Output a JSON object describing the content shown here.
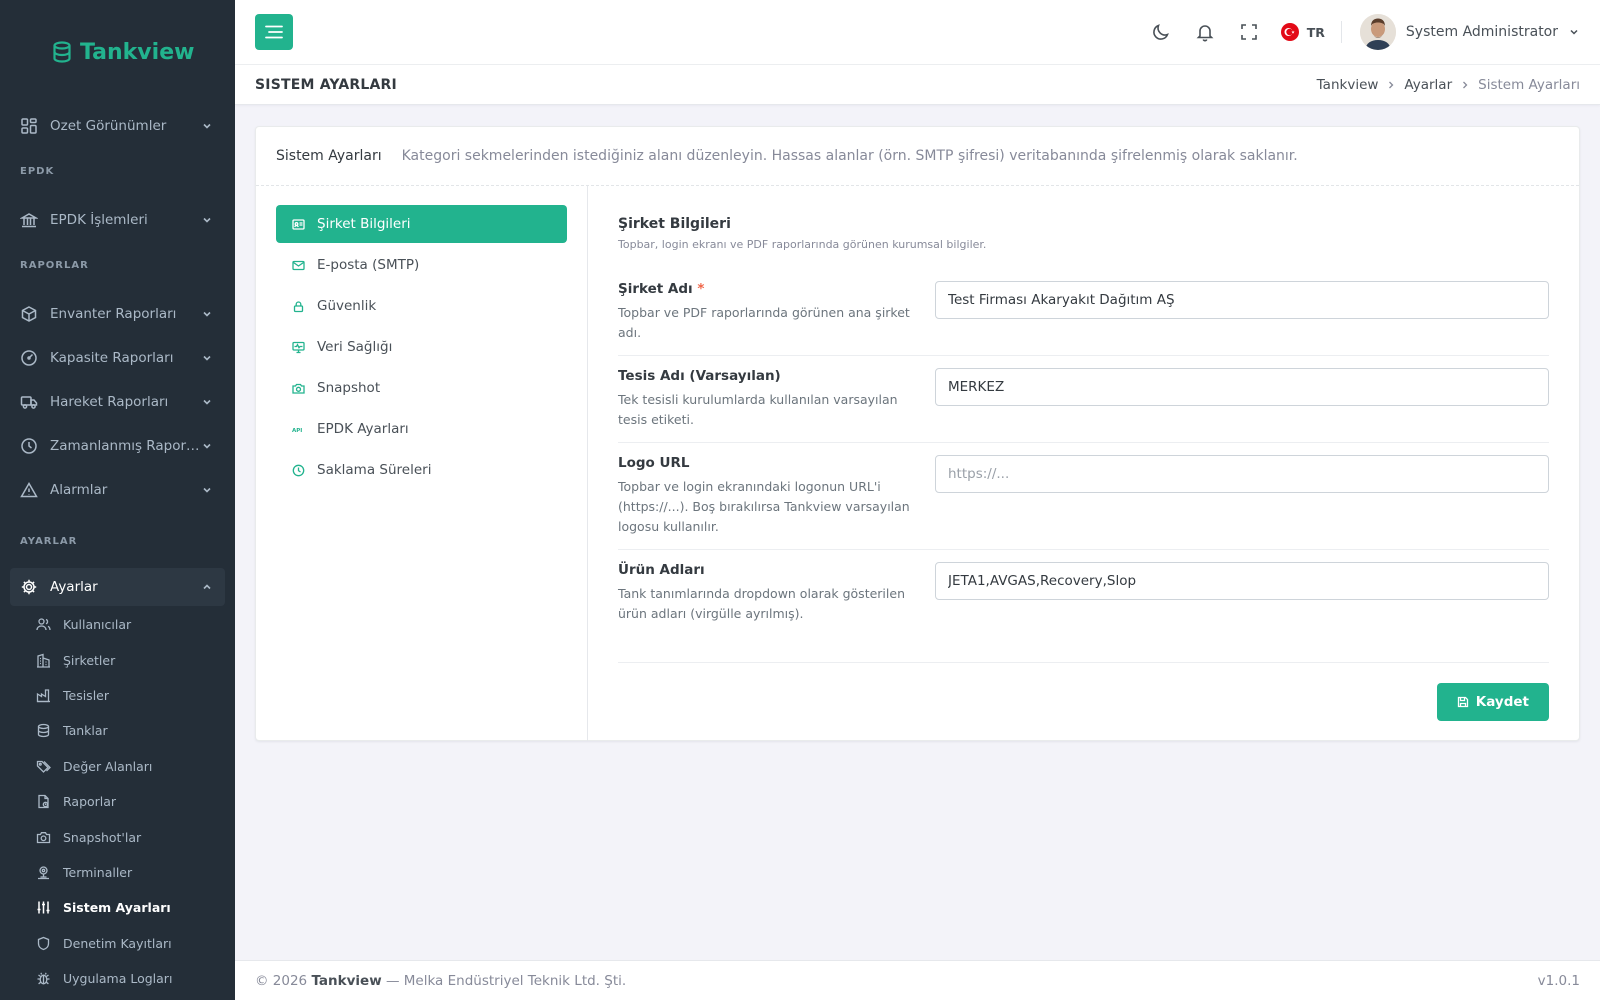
{
  "brand": {
    "name": "Tankview"
  },
  "sidebar": {
    "items": [
      {
        "label": "Ozet Görünümler"
      },
      {
        "section": "EPDK"
      },
      {
        "label": "EPDK İşlemleri"
      },
      {
        "section": "RAPORLAR"
      },
      {
        "label": "Envanter Raporları"
      },
      {
        "label": "Kapasite Raporları"
      },
      {
        "label": "Hareket Raporları"
      },
      {
        "label": "Zamanlanmış Raporlar"
      },
      {
        "label": "Alarmlar"
      },
      {
        "section": "AYARLAR"
      },
      {
        "label": "Ayarlar"
      }
    ],
    "sub_items": [
      "Kullanıcılar",
      "Şirketler",
      "Tesisler",
      "Tanklar",
      "Değer Alanları",
      "Raporlar",
      "Snapshot'lar",
      "Terminaller",
      "Sistem Ayarları",
      "Denetim Kayıtları",
      "Uygulama Logları"
    ]
  },
  "topbar": {
    "language": "TR",
    "user_name": "System Administrator"
  },
  "page": {
    "title": "SISTEM AYARLARI",
    "breadcrumb": [
      "Tankview",
      "Ayarlar",
      "Sistem Ayarları"
    ]
  },
  "card": {
    "title": "Sistem Ayarları",
    "description": "Kategori sekmelerinden istediğiniz alanı düzenleyin. Hassas alanlar (örn. SMTP şifresi) veritabanında şifrelenmiş olarak saklanır.",
    "tabs": [
      "Şirket Bilgileri",
      "E-posta (SMTP)",
      "Güvenlik",
      "Veri Sağlığı",
      "Snapshot",
      "EPDK Ayarları",
      "Saklama Süreleri"
    ],
    "active_tab": 0
  },
  "form": {
    "section_title": "Şirket Bilgileri",
    "section_desc": "Topbar, login ekranı ve PDF raporlarında görünen kurumsal bilgiler.",
    "fields": [
      {
        "label": "Şirket Adı",
        "required_mark": "*",
        "help": "Topbar ve PDF raporlarında görünen ana şirket adı.",
        "value": "Test Firması Akaryakıt Dağıtım AŞ",
        "placeholder": ""
      },
      {
        "label": "Tesis Adı (Varsayılan)",
        "help": "Tek tesisli kurulumlarda kullanılan varsayılan tesis etiketi.",
        "value": "MERKEZ",
        "placeholder": ""
      },
      {
        "label": "Logo URL",
        "help": "Topbar ve login ekranındaki logonun URL'i (https://...). Boş bırakılırsa Tankview varsayılan logosu kullanılır.",
        "value": "",
        "placeholder": "https://..."
      },
      {
        "label": "Ürün Adları",
        "help": "Tank tanımlarında dropdown olarak gösterilen ürün adları (virgülle ayrılmış).",
        "value": "JETA1,AVGAS,Recovery,Slop",
        "placeholder": ""
      }
    ],
    "save_label": "Kaydet"
  },
  "footer": {
    "copyright": "© 2026",
    "brand": "Tankview",
    "company": "— Melka Endüstriyel Teknik Ltd. Şti.",
    "version": "v1.0.1"
  },
  "colors": {
    "accent": "#22b38e",
    "sidebar_bg": "#242e38",
    "required": "#f06548"
  }
}
